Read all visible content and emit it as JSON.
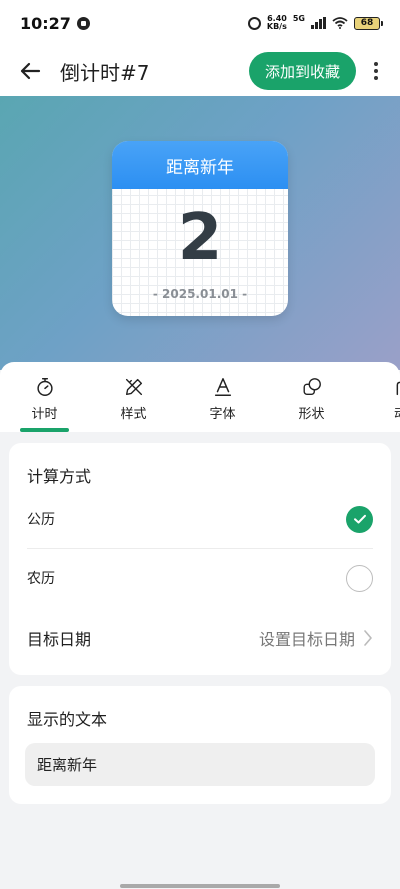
{
  "status_bar": {
    "time": "10:27",
    "net_speed_value": "6.40",
    "net_speed_unit": "KB/s",
    "network_type": "5G",
    "battery": "68",
    "icons": [
      "app-icon",
      "alarm-icon",
      "signal-icon",
      "wifi-icon",
      "battery-icon"
    ]
  },
  "app_bar": {
    "title": "倒计时#7",
    "favorite_button": "添加到收藏",
    "icons": [
      "back-arrow-icon",
      "more-vertical-icon"
    ]
  },
  "preview": {
    "header": "距离新年",
    "number": "2",
    "date": "- 2025.01.01 -"
  },
  "tabs": [
    {
      "label": "计时",
      "icon": "stopwatch-icon",
      "active": true
    },
    {
      "label": "样式",
      "icon": "pencil-ruler-icon",
      "active": false
    },
    {
      "label": "字体",
      "icon": "font-a-icon",
      "active": false
    },
    {
      "label": "形状",
      "icon": "shapes-icon",
      "active": false
    },
    {
      "label": "动",
      "icon": "animation-icon",
      "active": false
    }
  ],
  "calc": {
    "title": "计算方式",
    "options": [
      {
        "label": "公历",
        "selected": true
      },
      {
        "label": "农历",
        "selected": false
      }
    ],
    "target_date": {
      "label": "目标日期",
      "value": "设置目标日期"
    }
  },
  "text_section": {
    "title": "显示的文本",
    "value": "距离新年"
  },
  "colors": {
    "accent": "#1aa36a",
    "widget_header": "#2c8ff2"
  }
}
